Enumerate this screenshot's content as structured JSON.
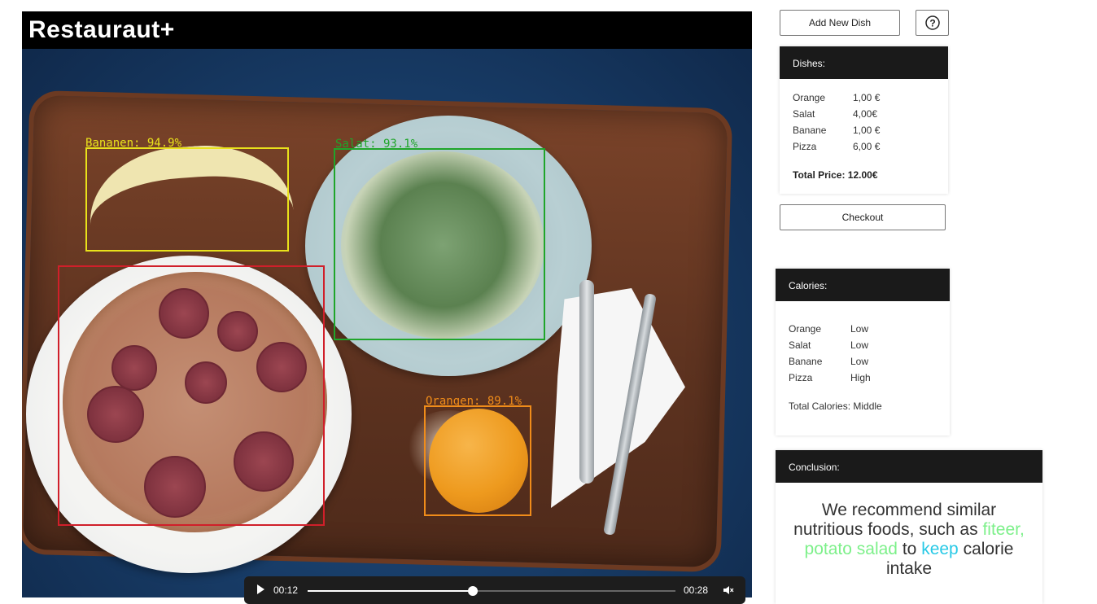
{
  "app": {
    "title": "Restauraut+"
  },
  "detections": [
    {
      "label": "Bananen: 94.9%",
      "color": "#e9e21b"
    },
    {
      "label": "Salat: 93.1%",
      "color": "#1fa52a"
    },
    {
      "label": "Orangen: 89.1%",
      "color": "#f08c1a"
    },
    {
      "label": "Pizza",
      "color": "#d01f2a"
    }
  ],
  "player": {
    "current_time": "00:12",
    "duration": "00:28",
    "progress": 0.45
  },
  "toolbar": {
    "add_dish_label": "Add New Dish",
    "help_icon": "question-circle-icon"
  },
  "dishes": {
    "title": "Dishes:",
    "items": [
      {
        "name": "Orange",
        "price": "1,00 €"
      },
      {
        "name": "Salat",
        "price": "4,00€"
      },
      {
        "name": "Banane",
        "price": "1,00 €"
      },
      {
        "name": "Pizza",
        "price": "6,00 €"
      }
    ],
    "total": "Total Price: 12.00€"
  },
  "checkout": {
    "label": "Checkout"
  },
  "calories": {
    "title": "Calories:",
    "items": [
      {
        "name": "Orange",
        "level": "Low"
      },
      {
        "name": "Salat",
        "level": "Low"
      },
      {
        "name": "Banane",
        "level": "Low"
      },
      {
        "name": "Pizza",
        "level": "High"
      }
    ],
    "total": "Total Calories: Middle"
  },
  "conclusion": {
    "title": "Conclusion:",
    "part1": "We recommend similar nutritious foods, such as",
    "highlight1": "fiteer, potato salad",
    "part2": "to",
    "highlight2": "keep",
    "part3": "calorie intake"
  }
}
